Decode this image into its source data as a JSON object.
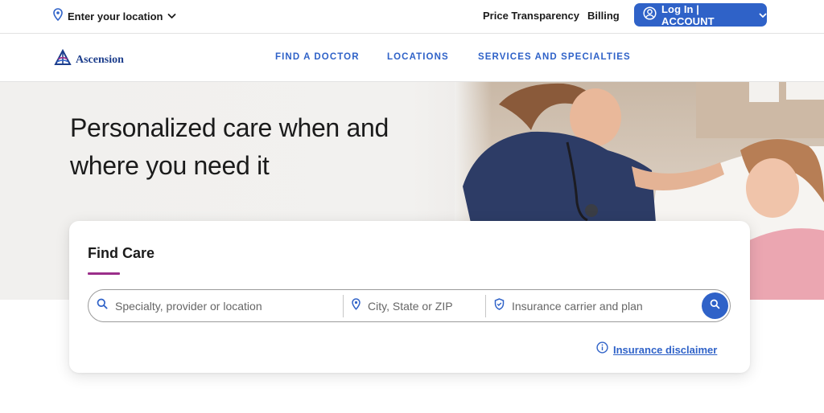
{
  "utility_bar": {
    "location_label": "Enter your location",
    "links": {
      "price_transparency": "Price Transparency",
      "billing": "Billing"
    },
    "login_label": "Log In | ACCOUNT"
  },
  "nav": {
    "logo_text": "Ascension",
    "links": {
      "find_doctor": "FIND A DOCTOR",
      "locations": "LOCATIONS",
      "services": "SERVICES AND SPECIALTIES"
    }
  },
  "hero": {
    "title": "Personalized care when and where you need it"
  },
  "find_care": {
    "title": "Find Care",
    "specialty_placeholder": "Specialty, provider or location",
    "location_placeholder": "City, State or ZIP",
    "insurance_placeholder": "Insurance carrier and plan",
    "disclaimer_label": "Insurance disclaimer"
  },
  "colors": {
    "brand_blue": "#2f62c8",
    "logo_navy": "#1d3e8c",
    "accent_purple": "#9b2f8a"
  },
  "icons": {
    "location": "map-pin-icon",
    "chevron": "chevron-down-icon",
    "account": "user-circle-icon",
    "search": "search-icon",
    "shield": "shield-icon",
    "info": "info-icon"
  }
}
